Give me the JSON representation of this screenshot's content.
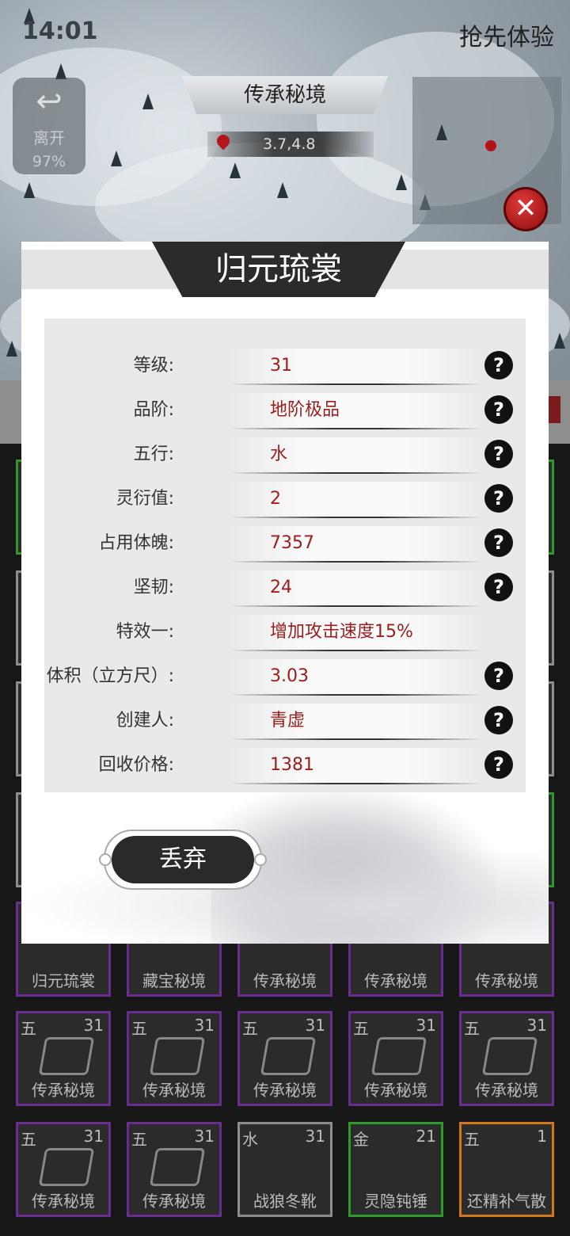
{
  "status": {
    "time": "14:01",
    "early_access": "抢先体验"
  },
  "hud": {
    "leave_label": "离开",
    "leave_percent": "97%",
    "map_title": "传承秘境",
    "coordinates": "3.7,4.8"
  },
  "dialog": {
    "title": "归元琉裳",
    "rows": [
      {
        "label": "等级:",
        "value": "31",
        "help": true
      },
      {
        "label": "品阶:",
        "value": "地阶极品",
        "help": true
      },
      {
        "label": "五行:",
        "value": "水",
        "help": true
      },
      {
        "label": "灵衍值:",
        "value": "2",
        "help": true
      },
      {
        "label": "占用体魄:",
        "value": "7357",
        "help": true
      },
      {
        "label": "坚韧:",
        "value": "24",
        "help": true
      },
      {
        "label": "特效一:",
        "value": "增加攻击速度15%",
        "help": false
      },
      {
        "label": "体积（立方尺）:",
        "value": "3.03",
        "help": true
      },
      {
        "label": "创建人:",
        "value": "青虚",
        "help": true
      },
      {
        "label": "回收价格:",
        "value": "1381",
        "help": true
      }
    ],
    "help_glyph": "?",
    "discard_label": "丢弃"
  },
  "inventory": {
    "row_partial": [
      {
        "name": "归元琉裳"
      },
      {
        "name": "藏宝秘境"
      },
      {
        "name": "传承秘境"
      },
      {
        "name": "传承秘境"
      },
      {
        "name": "传承秘境"
      }
    ],
    "row_full": [
      {
        "elem": "五",
        "lvl": "31",
        "name": "传承秘境"
      },
      {
        "elem": "五",
        "lvl": "31",
        "name": "传承秘境"
      },
      {
        "elem": "五",
        "lvl": "31",
        "name": "传承秘境"
      },
      {
        "elem": "五",
        "lvl": "31",
        "name": "传承秘境"
      },
      {
        "elem": "五",
        "lvl": "31",
        "name": "传承秘境"
      }
    ],
    "row_bottom": [
      {
        "elem": "五",
        "lvl": "31",
        "name": "传承秘境"
      },
      {
        "elem": "五",
        "lvl": "31",
        "name": "传承秘境"
      },
      {
        "elem": "水",
        "lvl": "31",
        "name": "战狼冬靴"
      },
      {
        "elem": "金",
        "lvl": "21",
        "name": "灵隐钝锤"
      },
      {
        "elem": "五",
        "lvl": "1",
        "name": "还精补气散"
      }
    ]
  },
  "colors": {
    "accent_red": "#9a1d1d",
    "rare_purple": "#6a2c8f",
    "uncommon_green": "#2e9a2e",
    "epic_orange": "#d4761d"
  }
}
